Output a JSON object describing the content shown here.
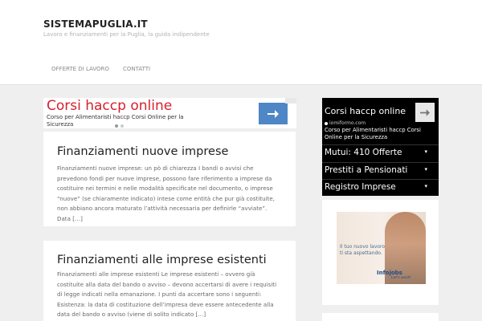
{
  "header": {
    "site_title": "SISTEMAPUGLIA.IT",
    "site_description": "Lavoro e finanziamenti per la Puglia, la guida indipendente"
  },
  "nav": {
    "items": [
      {
        "label": "OFFERTE DI LAVORO"
      },
      {
        "label": "CONTATTI"
      }
    ]
  },
  "ad_top": {
    "title": "Corsi haccp online",
    "subtitle": "Corso per Alimentaristi haccp Corsi Online per la Sicurezza",
    "button_icon": "arrow-right-icon",
    "accent_color": "#d6202e",
    "button_color": "#4f86c6"
  },
  "posts": [
    {
      "title": "Finanziamenti nuove imprese",
      "excerpt": "Finanziamenti nuove imprese: un pò di chiarezza I bandi o avvisi che prevedono fondi per nuove imprese, possono fare riferimento a imprese da costituire nei termini e nelle modalità specificate nel documento, o imprese “nuove” (se chiaramente indicato) intese come entità che pur già costituite, non abbiano ancora maturato l’attività necessaria per definirle “avviate”. Data",
      "more": "[…]"
    },
    {
      "title": "Finanziamenti alle imprese esistenti",
      "excerpt": "Finanziamenti alle imprese esistenti Le imprese esistenti – ovvero già costituite alla data del bando o avviso – devono accertarsi di avere i requisiti di legge indicati nella emanazione. I punti da accertare sono i seguenti: Esistenza: la data di costituzione dell’impresa deve essere antecedente alla data del bando o avviso (viene di solito indicato",
      "more": "[…]"
    }
  ],
  "sidebar_ad": {
    "title": "Corsi haccp online",
    "domain": "iomiformo.com",
    "subtitle": "Corso per Alimentaristi haccp Corsi Online per la Sicurezza",
    "button_icon": "arrow-right-icon",
    "links": [
      {
        "label": "Mutui: 410 Offerte",
        "icon": "chevron-down-icon"
      },
      {
        "label": "Prestiti a Pensionati",
        "icon": "chevron-down-icon"
      },
      {
        "label": "Registro Imprese",
        "icon": "chevron-down-icon"
      }
    ]
  },
  "sidebar_banner": {
    "text": "Il tuo nuovo lavoro ti sta aspettando.",
    "logo": "Infojobs",
    "logo_tagline": "Let's work!"
  }
}
